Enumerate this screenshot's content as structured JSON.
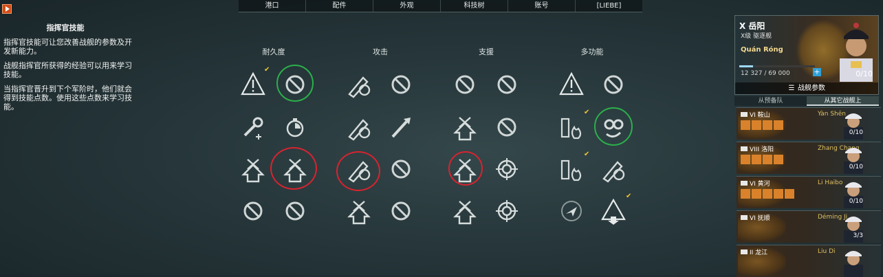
{
  "top_nav": [
    "港口",
    "配件",
    "外观",
    "科技树",
    "账号",
    "[LIEBE]"
  ],
  "sidebar": {
    "title": "指挥官技能",
    "paragraphs": [
      "指挥官技能可让您改善战舰的参数及开发新能力。",
      "战舰指挥官所获得的经验可以用来学习技能。",
      "当指挥官晋升到下个军阶时，他们就会得到技能点数。使用这些点数来学习技能。"
    ]
  },
  "categories": [
    "耐久度",
    "攻击",
    "支援",
    "多功能"
  ],
  "ship": {
    "tier_name": "X 岳阳",
    "class": "X级 驱逐舰",
    "commander": "Quán Róng",
    "xp": "12 327 / 69 000",
    "xp_progress": 0.18,
    "points": "0/10",
    "params_label": "战舰参数",
    "plus": "+"
  },
  "roster_tabs": [
    "从预备队",
    "从其它战舰上"
  ],
  "crew": [
    {
      "ship": "VI 鞍山",
      "name": "Yàn Shēn",
      "points": "0/10"
    },
    {
      "ship": "VIII 洛阳",
      "name": "Zhang Chang",
      "points": "0/10"
    },
    {
      "ship": "VI 黄河",
      "name": "Li Haibo",
      "points": "0/10"
    },
    {
      "ship": "VI 抚顺",
      "name": "Déming Ji",
      "points": "3/3"
    },
    {
      "ship": "II 龙江",
      "name": "Liu Di",
      "points": ""
    }
  ],
  "colors": {
    "learned_ring": "#2bb04a",
    "highlight_ring": "#d9232f",
    "accent": "#f0c730"
  }
}
